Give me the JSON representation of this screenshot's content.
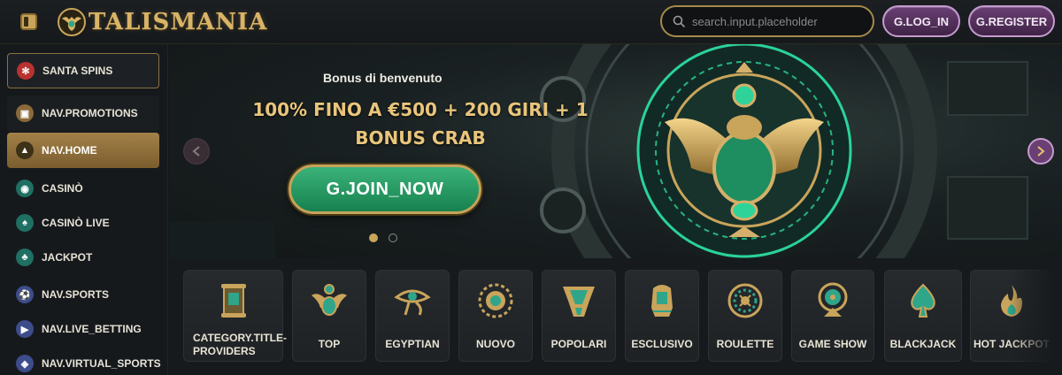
{
  "header": {
    "logo_text": "TALISMANIA",
    "search": {
      "placeholder": "search.input.placeholder"
    },
    "login_label": "G.LOG_IN",
    "register_label": "G.REGISTER"
  },
  "sidebar": {
    "items": [
      {
        "label": "SANTA SPINS",
        "icon": "snowflake-icon"
      },
      {
        "label": "NAV.PROMOTIONS",
        "icon": "gift-icon"
      },
      {
        "label": "NAV.HOME",
        "icon": "pyramid-icon",
        "active": true
      },
      {
        "label": "CASINÒ",
        "icon": "casino-chip-icon"
      },
      {
        "label": "CASINÒ LIVE",
        "icon": "spade-icon"
      },
      {
        "label": "JACKPOT",
        "icon": "clover-icon"
      },
      {
        "label": "NAV.SPORTS",
        "icon": "soccer-ball-icon"
      },
      {
        "label": "NAV.LIVE_BETTING",
        "icon": "live-tv-icon"
      },
      {
        "label": "NAV.VIRTUAL_SPORTS",
        "icon": "gamepad-icon"
      }
    ]
  },
  "hero": {
    "subtitle": "Bonus di benvenuto",
    "title_line1": "100% FINO A €500 + 200 GIRI + 1",
    "title_line2": "BONUS CRAB",
    "cta_label": "G.JOIN_NOW",
    "slides": {
      "current": 1,
      "total": 2
    }
  },
  "categories": [
    {
      "label": "CATEGORY.TITLE-PROVIDERS",
      "icon": "scroll-icon"
    },
    {
      "label": "TOP",
      "icon": "scarab-icon"
    },
    {
      "label": "EGYPTIAN",
      "icon": "eye-of-horus-icon"
    },
    {
      "label": "NUOVO",
      "icon": "sun-disc-icon"
    },
    {
      "label": "POPOLARI",
      "icon": "headdress-icon"
    },
    {
      "label": "ESCLUSIVO",
      "icon": "pharaoh-icon"
    },
    {
      "label": "ROULETTE",
      "icon": "roulette-wheel-icon"
    },
    {
      "label": "GAME SHOW",
      "icon": "money-wheel-icon"
    },
    {
      "label": "BLACKJACK",
      "icon": "spade-card-icon"
    },
    {
      "label": "HOT JACKPOT",
      "icon": "flame-icon"
    }
  ],
  "colors": {
    "gold": "#c9a45b",
    "purple_button": "#6a3f74",
    "green_cta": "#2a9c66",
    "teal_icon": "#2fa58a"
  }
}
